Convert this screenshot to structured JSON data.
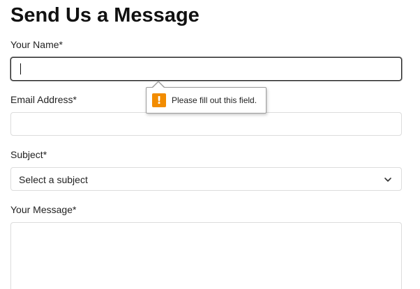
{
  "form": {
    "title": "Send Us a Message",
    "name_label": "Your Name*",
    "name_value": "",
    "email_label": "Email Address*",
    "email_value": "",
    "subject_label": "Subject*",
    "subject_selected": "Select a subject",
    "message_label": "Your Message*",
    "message_value": ""
  },
  "validation_tooltip": {
    "message": "Please fill out this field.",
    "icon": "warning-icon",
    "icon_glyph": "!",
    "icon_color": "#f28c00"
  },
  "icons": {
    "subject_dropdown": "chevron-down-icon"
  }
}
